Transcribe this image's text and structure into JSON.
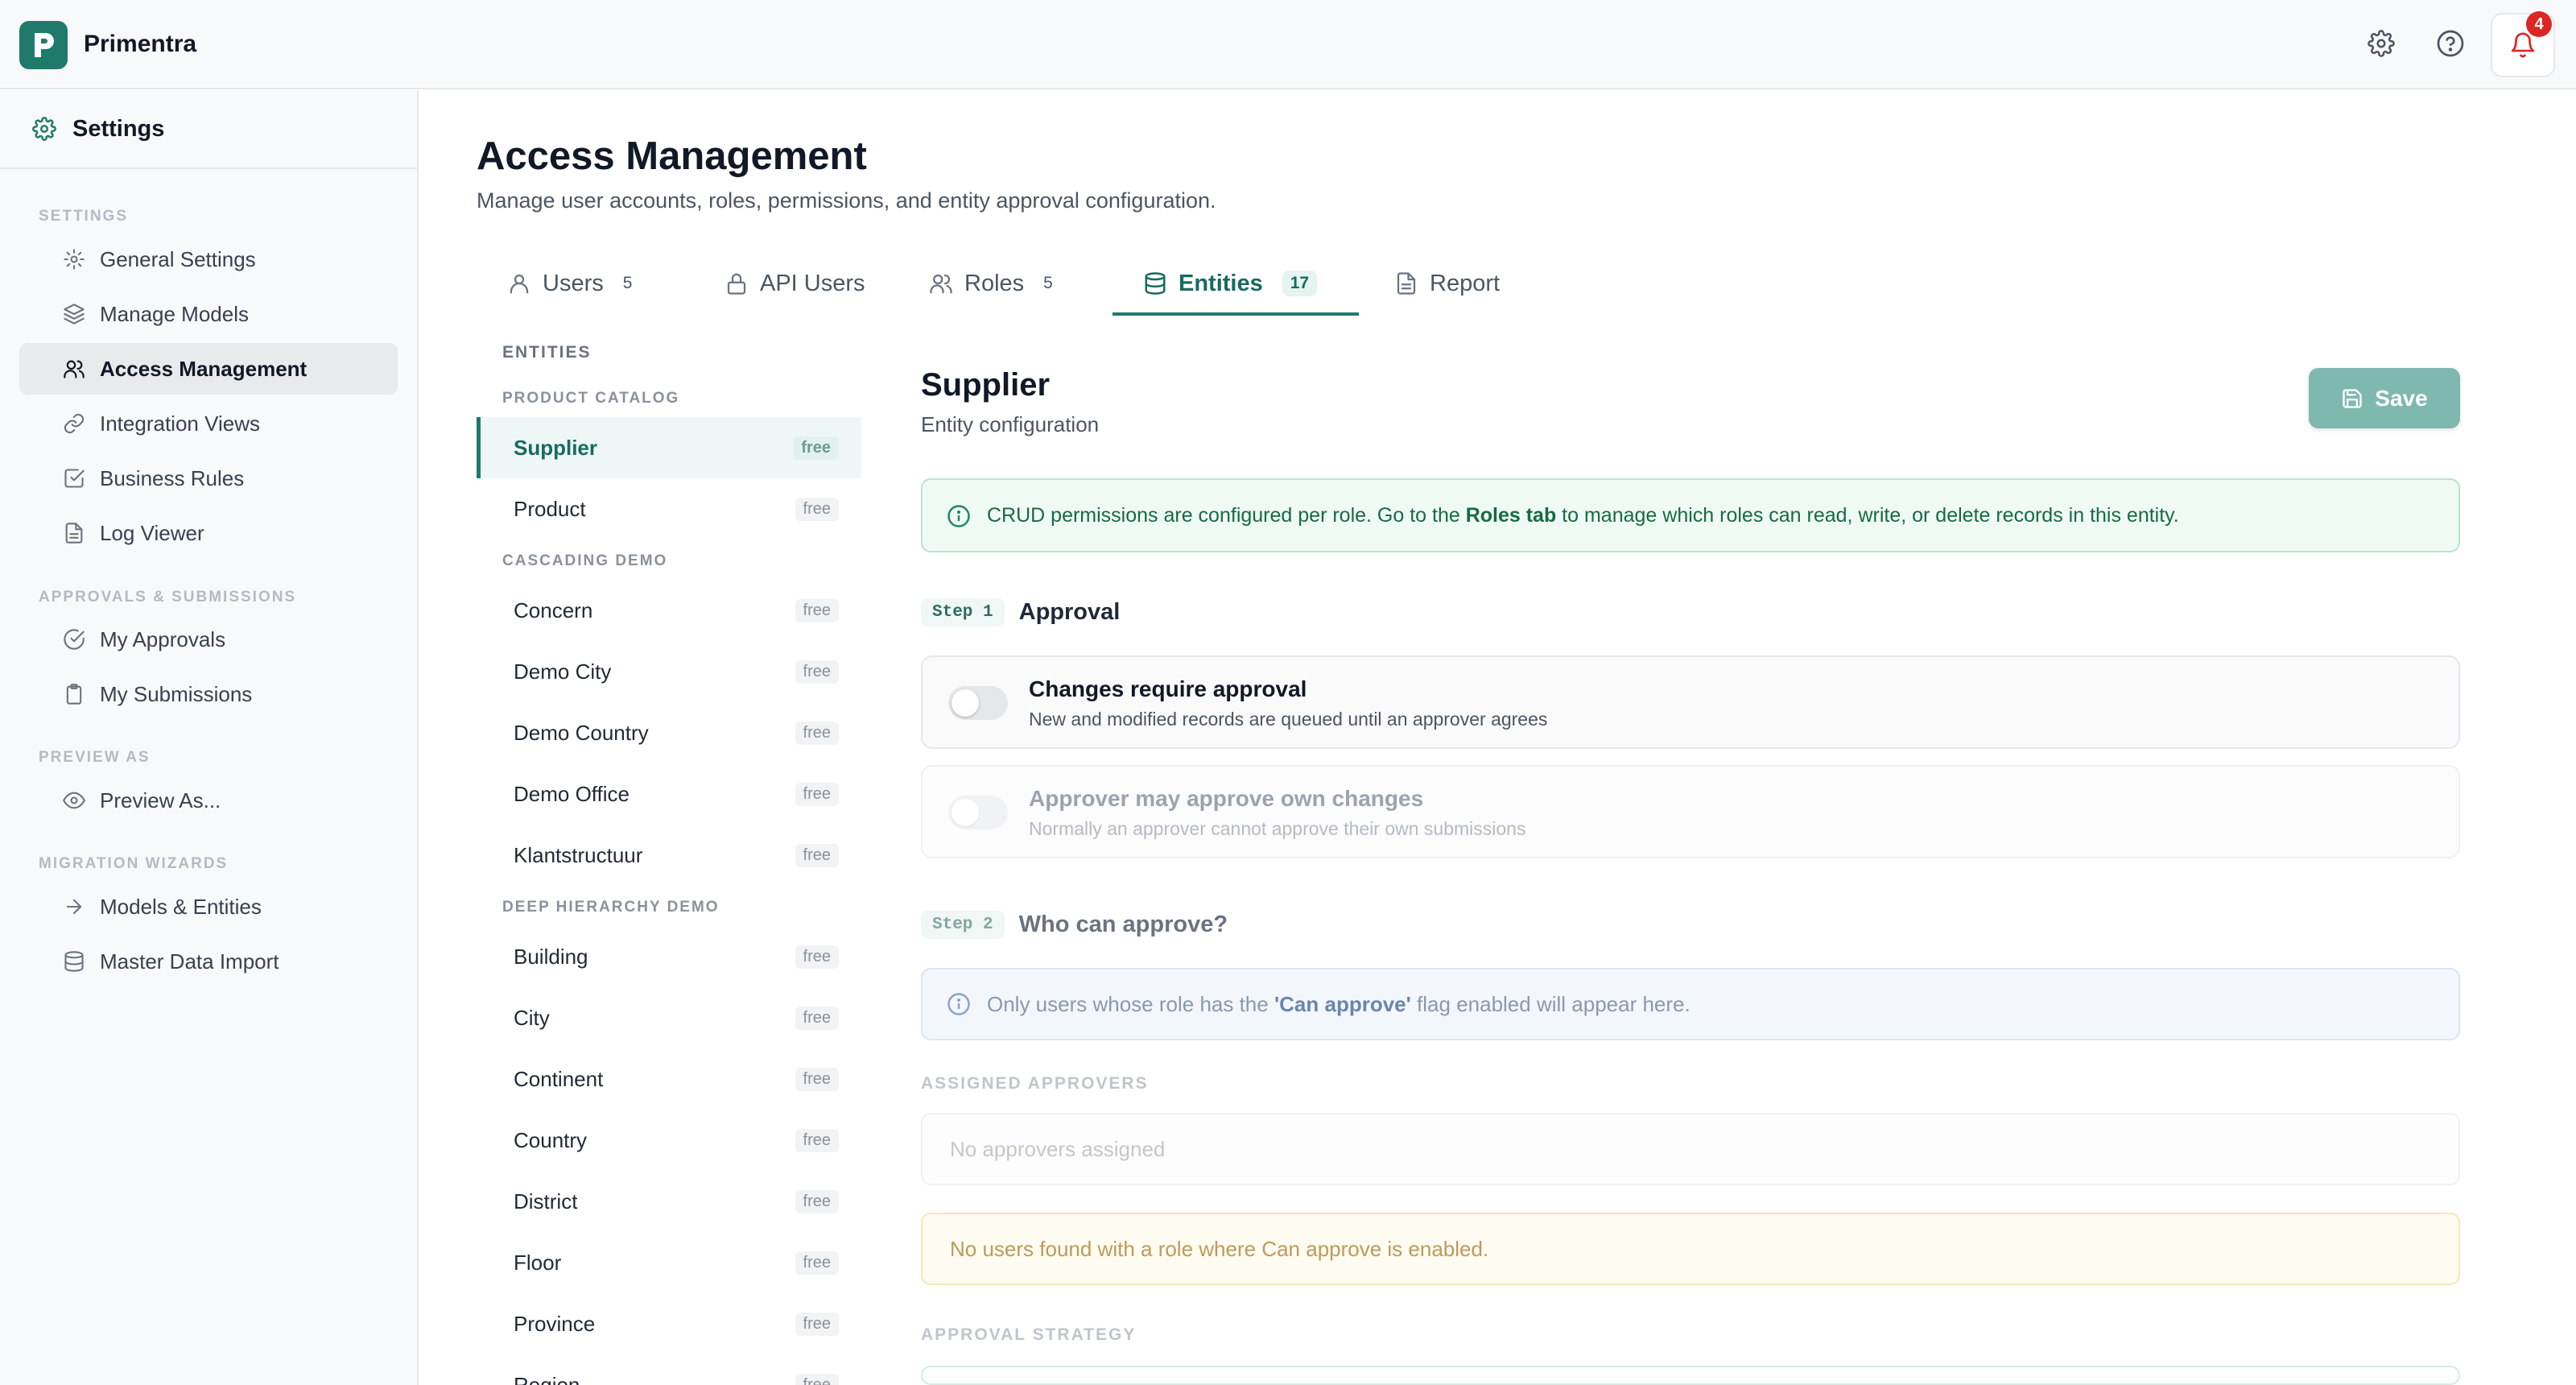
{
  "app": {
    "name": "Primentra",
    "notification_count": "4"
  },
  "icons": {
    "logo": "primentra-logo-icon",
    "settings": "gear-icon",
    "help": "help-circle-icon",
    "notifications": "bell-icon"
  },
  "colors": {
    "brand": "#1f7a6c",
    "badge": "#dc2626",
    "save_button": "#7fb8ae"
  },
  "sidebar": {
    "title": "Settings",
    "sections": [
      {
        "label": "SETTINGS",
        "items": [
          {
            "label": "General Settings",
            "icon": "gear-icon"
          },
          {
            "label": "Manage Models",
            "icon": "layers-icon"
          },
          {
            "label": "Access Management",
            "icon": "users-icon",
            "active": true
          },
          {
            "label": "Integration Views",
            "icon": "link-icon"
          },
          {
            "label": "Business Rules",
            "icon": "check-square-icon"
          },
          {
            "label": "Log Viewer",
            "icon": "file-text-icon"
          }
        ]
      },
      {
        "label": "APPROVALS & SUBMISSIONS",
        "items": [
          {
            "label": "My Approvals",
            "icon": "check-circle-icon"
          },
          {
            "label": "My Submissions",
            "icon": "clipboard-icon"
          }
        ]
      },
      {
        "label": "PREVIEW AS",
        "items": [
          {
            "label": "Preview As...",
            "icon": "eye-icon"
          }
        ]
      },
      {
        "label": "MIGRATION WIZARDS",
        "items": [
          {
            "label": "Models & Entities",
            "icon": "arrow-right-icon"
          },
          {
            "label": "Master Data Import",
            "icon": "database-icon"
          }
        ]
      }
    ]
  },
  "page": {
    "title": "Access Management",
    "subtitle": "Manage user accounts, roles, permissions, and entity approval configuration."
  },
  "tabs": [
    {
      "label": "Users",
      "count": "5",
      "icon": "user-icon"
    },
    {
      "label": "API Users",
      "count": "",
      "icon": "lock-icon"
    },
    {
      "label": "Roles",
      "count": "5",
      "icon": "users-icon"
    },
    {
      "label": "Entities",
      "count": "17",
      "icon": "database-icon",
      "active": true
    },
    {
      "label": "Report",
      "count": "",
      "icon": "file-text-icon"
    }
  ],
  "entities": {
    "heading": "ENTITIES",
    "groups": [
      {
        "name": "PRODUCT CATALOG",
        "items": [
          {
            "name": "Supplier",
            "tier": "free",
            "active": true
          },
          {
            "name": "Product",
            "tier": "free"
          }
        ]
      },
      {
        "name": "CASCADING DEMO",
        "items": [
          {
            "name": "Concern",
            "tier": "free"
          },
          {
            "name": "Demo City",
            "tier": "free"
          },
          {
            "name": "Demo Country",
            "tier": "free"
          },
          {
            "name": "Demo Office",
            "tier": "free"
          },
          {
            "name": "Klantstructuur",
            "tier": "free"
          }
        ]
      },
      {
        "name": "DEEP HIERARCHY DEMO",
        "items": [
          {
            "name": "Building",
            "tier": "free"
          },
          {
            "name": "City",
            "tier": "free"
          },
          {
            "name": "Continent",
            "tier": "free"
          },
          {
            "name": "Country",
            "tier": "free"
          },
          {
            "name": "District",
            "tier": "free"
          },
          {
            "name": "Floor",
            "tier": "free"
          },
          {
            "name": "Province",
            "tier": "free"
          },
          {
            "name": "Region",
            "tier": "free"
          }
        ]
      }
    ]
  },
  "config": {
    "title": "Supplier",
    "subtitle": "Entity configuration",
    "save_label": "Save",
    "crud_info": {
      "before": "CRUD permissions are configured per role. Go to the ",
      "link": "Roles tab",
      "after": " to manage which roles can read, write, or delete records in this entity."
    },
    "step1": {
      "badge": "Step 1",
      "title": "Approval"
    },
    "toggles": [
      {
        "title": "Changes require approval",
        "description": "New and modified records are queued until an approver agrees",
        "on": false
      },
      {
        "title": "Approver may approve own changes",
        "description": "Normally an approver cannot approve their own submissions",
        "on": false
      }
    ],
    "step2": {
      "badge": "Step 2",
      "title": "Who can approve?"
    },
    "approve_info": {
      "before": "Only users whose role has the ",
      "flag": "'Can approve'",
      "after": " flag enabled will appear here."
    },
    "assigned_label": "ASSIGNED APPROVERS",
    "assigned_empty": "No approvers assigned",
    "warning": "No users found with a role where Can approve is enabled.",
    "strategy_label": "APPROVAL STRATEGY"
  }
}
